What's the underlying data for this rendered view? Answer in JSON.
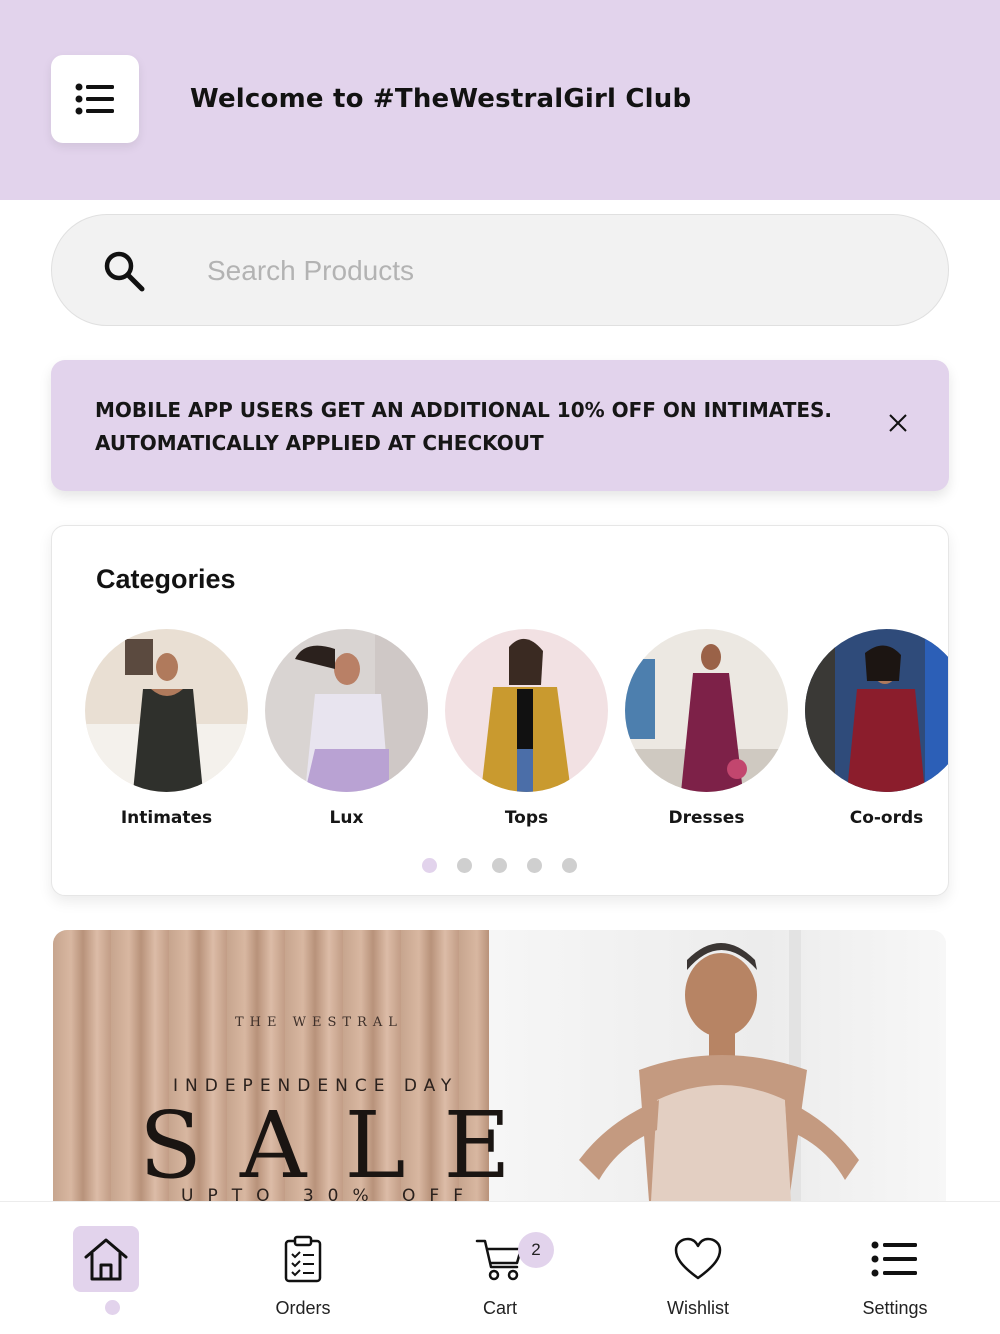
{
  "header": {
    "title": "Welcome to #TheWestralGirl Club",
    "menu_icon": "list-menu-icon"
  },
  "search": {
    "placeholder": "Search Products",
    "value": ""
  },
  "promo": {
    "line1": "MOBILE APP USERS GET AN ADDITIONAL 10% OFF ON INTIMATES.",
    "line2": "AUTOMATICALLY APPLIED AT CHECKOUT"
  },
  "categories": {
    "title": "Categories",
    "items": [
      {
        "label": "Intimates"
      },
      {
        "label": "Lux"
      },
      {
        "label": "Tops"
      },
      {
        "label": "Dresses"
      },
      {
        "label": "Co-ords"
      }
    ],
    "pages": 5,
    "active_page": 1
  },
  "sale_banner": {
    "brand": "THE WESTRAL",
    "subtitle": "INDEPENDENCE DAY",
    "headline": "SALE",
    "offer": "UPTO 30% OFF"
  },
  "bottom_nav": {
    "items": [
      {
        "label": "",
        "icon": "home-icon",
        "active": true
      },
      {
        "label": "Orders",
        "icon": "clipboard-icon"
      },
      {
        "label": "Cart",
        "icon": "cart-icon",
        "badge": "2"
      },
      {
        "label": "Wishlist",
        "icon": "heart-icon"
      },
      {
        "label": "Settings",
        "icon": "list-menu-icon"
      }
    ]
  },
  "colors": {
    "accent": "#e2d3ec",
    "text": "#121212",
    "search_bg": "#f2f2f2"
  }
}
